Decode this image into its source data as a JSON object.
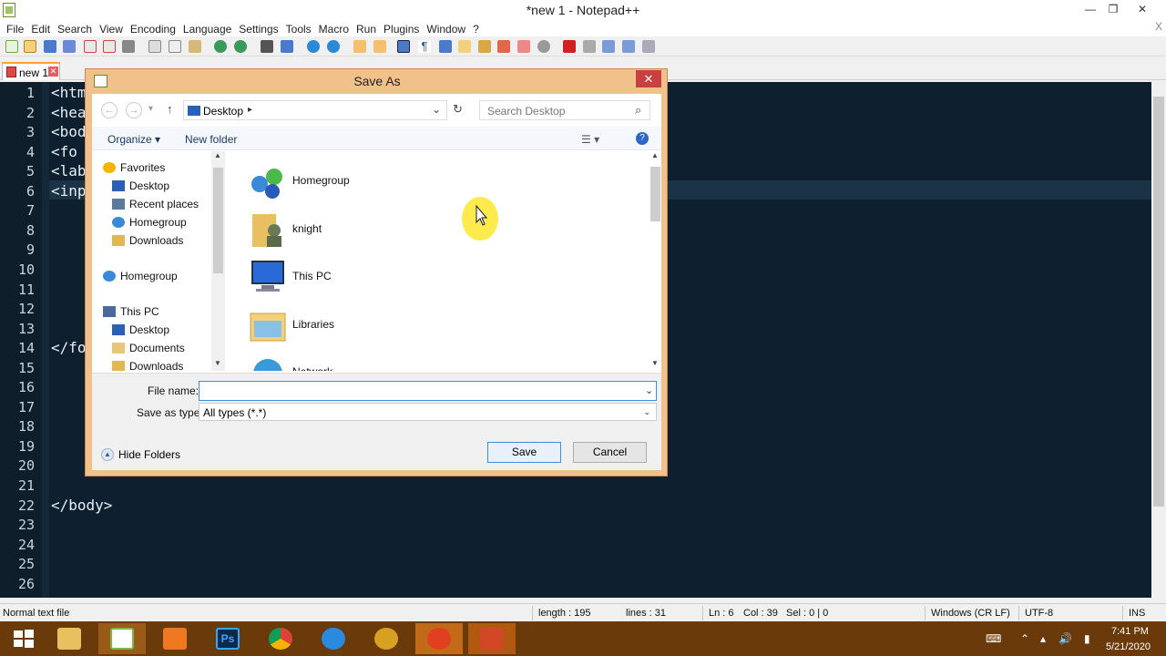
{
  "window": {
    "title": "*new 1 - Notepad++",
    "min": "—",
    "max": "❐",
    "close": "✕"
  },
  "menu": {
    "items": [
      "File",
      "Edit",
      "Search",
      "View",
      "Encoding",
      "Language",
      "Settings",
      "Tools",
      "Macro",
      "Run",
      "Plugins",
      "Window",
      "?"
    ],
    "close": "X"
  },
  "tab": {
    "label": "new 1",
    "close": "✕"
  },
  "editor": {
    "lines": [
      {
        "n": "1",
        "text": "<htm"
      },
      {
        "n": "2",
        "text": "<hea"
      },
      {
        "n": "3",
        "text": "<bod"
      },
      {
        "n": "4",
        "text": "<fo"
      },
      {
        "n": "5",
        "text": "<lab"
      },
      {
        "n": "6",
        "text": "<inp"
      },
      {
        "n": "7",
        "text": ""
      },
      {
        "n": "8",
        "text": ""
      },
      {
        "n": "9",
        "text": ""
      },
      {
        "n": "10",
        "text": ""
      },
      {
        "n": "11",
        "text": ""
      },
      {
        "n": "12",
        "text": ""
      },
      {
        "n": "13",
        "text": ""
      },
      {
        "n": "14",
        "text": "</fo"
      },
      {
        "n": "15",
        "text": ""
      },
      {
        "n": "16",
        "text": ""
      },
      {
        "n": "17",
        "text": ""
      },
      {
        "n": "18",
        "text": ""
      },
      {
        "n": "19",
        "text": ""
      },
      {
        "n": "20",
        "text": ""
      },
      {
        "n": "21",
        "text": ""
      },
      {
        "n": "22",
        "text": "</body>"
      },
      {
        "n": "23",
        "text": ""
      },
      {
        "n": "24",
        "text": ""
      },
      {
        "n": "25",
        "text": ""
      },
      {
        "n": "26",
        "text": ""
      }
    ]
  },
  "status": {
    "type": "Normal text file",
    "length": "length : 195",
    "lines": "lines : 31",
    "ln": "Ln : 6",
    "col": "Col : 39",
    "sel": "Sel : 0 | 0",
    "eol": "Windows (CR LF)",
    "encoding": "UTF-8",
    "mode": "INS"
  },
  "dialog": {
    "title": "Save As",
    "close": "✕",
    "nav": {
      "back": "←",
      "forward": "→",
      "recent": "▾",
      "up": "↑",
      "refresh": "↻"
    },
    "address": {
      "location": "Desktop",
      "sep": "▸",
      "dropdown": "⌄"
    },
    "search_placeholder": "Search Desktop",
    "search_icon": "⌕",
    "organize": "Organize ▾",
    "new_folder": "New folder",
    "view_icon": "☰ ▾",
    "help": "?",
    "nav_pane": [
      {
        "label": "Favorites",
        "icon": "star-icon",
        "level": 0
      },
      {
        "label": "Desktop",
        "icon": "desktop-icon",
        "level": 1
      },
      {
        "label": "Recent places",
        "icon": "recent-places-icon",
        "level": 1
      },
      {
        "label": "Homegroup",
        "icon": "homegroup-icon",
        "level": 1
      },
      {
        "label": "Downloads",
        "icon": "downloads-icon",
        "level": 1
      },
      {
        "label": "Homegroup",
        "icon": "homegroup-icon",
        "level": 0
      },
      {
        "label": "This PC",
        "icon": "pc-icon",
        "level": 0
      },
      {
        "label": "Desktop",
        "icon": "desktop-icon",
        "level": 1
      },
      {
        "label": "Documents",
        "icon": "documents-icon",
        "level": 1
      },
      {
        "label": "Downloads",
        "icon": "downloads-icon",
        "level": 1
      }
    ],
    "files": [
      {
        "label": "Homegroup",
        "icon": "homegroup-icon"
      },
      {
        "label": "knight",
        "icon": "user-folder-icon"
      },
      {
        "label": "This PC",
        "icon": "pc-icon"
      },
      {
        "label": "Libraries",
        "icon": "libraries-icon"
      },
      {
        "label": "Network",
        "icon": "network-icon"
      }
    ],
    "file_name_label": "File name:",
    "file_name_value": "",
    "save_type_label": "Save as type:",
    "save_type_value": "All types (*.*)",
    "chevron": "⌄",
    "save": "Save",
    "cancel": "Cancel",
    "hide_folders": "Hide Folders",
    "hide_icon": "▲"
  },
  "taskbar": {
    "time": "7:41 PM",
    "date": "5/21/2020",
    "tray_keyboard": "⌨",
    "tray_up": "⌃",
    "tray_signal": "▴",
    "tray_sound": "🔊",
    "tray_battery": "▮"
  }
}
